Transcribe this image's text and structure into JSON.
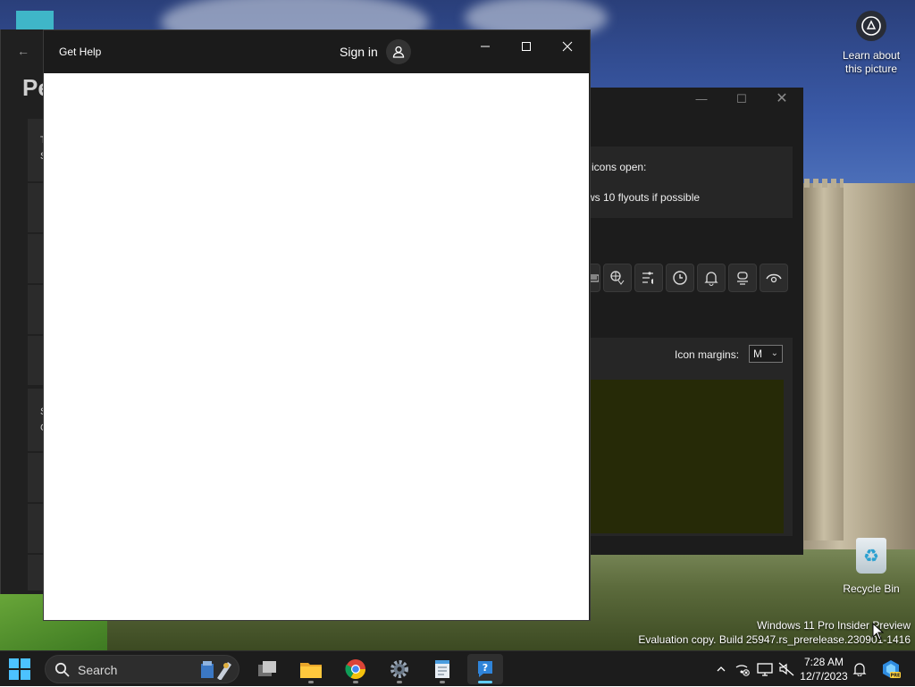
{
  "desktop": {
    "learn_label_line1": "Learn about",
    "learn_label_line2": "this picture",
    "recycle_bin_label": "Recycle Bin",
    "watermark_line1": "Windows 11 Pro Insider Preview",
    "watermark_line2": "Evaluation copy. Build 25947.rs_prerelease.230901-1416"
  },
  "settings_window": {
    "title_fragment": "Pe",
    "card_letters": [
      "T",
      "S",
      "S",
      "C"
    ]
  },
  "mid_window": {
    "text_icons_open": "icons open:",
    "text_flyouts": "ws 10 flyouts if possible",
    "icon_margins_label": "Icon margins:",
    "icon_margins_value": "M",
    "icons": [
      "keyboard-icon",
      "language-icon",
      "volume-settings-icon",
      "clock-icon",
      "bell-icon",
      "headset-icon",
      "eye-icon"
    ],
    "preview_color": "#262a07"
  },
  "help_window": {
    "title": "Get Help",
    "sign_in_label": "Sign in"
  },
  "taskbar": {
    "search_label": "Search",
    "apps": [
      "task-view",
      "file-explorer",
      "chrome",
      "settings",
      "notepad",
      "get-help"
    ],
    "active_app": "get-help",
    "accent": "#60cdff"
  },
  "tray": {
    "time": "7:28 AM",
    "date": "12/7/2023"
  }
}
